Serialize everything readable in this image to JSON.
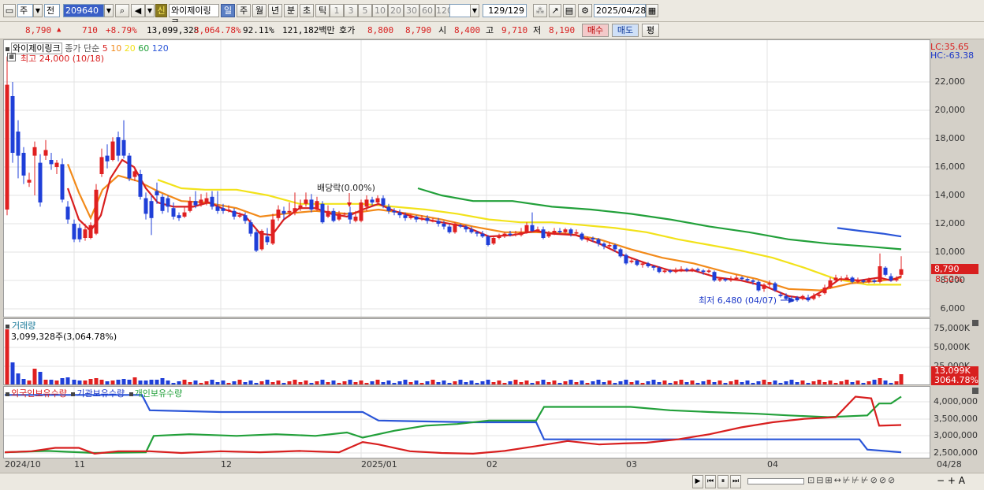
{
  "toolbar": {
    "market_select": "주",
    "mode_select": "전",
    "code": "209640",
    "stock_name": "와이제이링크",
    "new_badge": "신",
    "period_tabs": [
      "일",
      "주",
      "월",
      "년",
      "분",
      "초",
      "틱"
    ],
    "interval_tabs": [
      "1",
      "3",
      "5",
      "10",
      "20",
      "30",
      "60",
      "120"
    ],
    "counter": "129/129",
    "date": "2025/04/28"
  },
  "info": {
    "price": "8,790",
    "arrow": "▲",
    "change": "710",
    "change_pct": "+8.79%",
    "volume": "13,099,328",
    "volume_pct": "3,064.78%",
    "ratio": "92.11%",
    "amount": "121,182백만",
    "quote_label": "호가",
    "quote1": "8,800",
    "quote2": "8,790",
    "open_label": "시",
    "open": "8,400",
    "high_label": "고",
    "high": "9,710",
    "low_label": "저",
    "low": "8,190",
    "buy_button": "매수",
    "sell_button": "매도",
    "eval_button": "평"
  },
  "price_panel": {
    "legend_name": "와이제이링크",
    "legend_close": "종가 단순",
    "ma_labels": [
      {
        "label": "5",
        "color": "#d81f1f"
      },
      {
        "label": "10",
        "color": "#f28a1a"
      },
      {
        "label": "20",
        "color": "#f2e21a"
      },
      {
        "label": "60",
        "color": "#22a03a"
      },
      {
        "label": "120",
        "color": "#2a55d8"
      }
    ],
    "high_note": "최고 24,000 (10/18)",
    "low_note": "최저 6,480 (04/07)",
    "dividend_note": "배당락(0.00%)",
    "lc": "LC:35.65",
    "hc": "HC:-63.38",
    "current_price_tag": "8,790",
    "current_pct_tag": "8.52%",
    "y_ticks": [
      "22,000",
      "20,000",
      "18,000",
      "16,000",
      "14,000",
      "12,000",
      "10,000",
      "8,000",
      "6,000"
    ]
  },
  "volume_panel": {
    "title": "거래량",
    "value": "3,099,328주(3,064.78%)",
    "y_ticks": [
      "75,000K",
      "50,000K",
      "25,000K"
    ],
    "tag1": "13,099K",
    "tag2": "3064.78%"
  },
  "holding_panel": {
    "legend": [
      "외국인보유수량",
      "기관보유수량",
      "개인보유수량"
    ],
    "legend_colors": [
      "#d81f1f",
      "#2a55d8",
      "#22a03a"
    ],
    "y_ticks": [
      "4,000,000",
      "3,500,000",
      "3,000,000",
      "2,500,000"
    ]
  },
  "x_axis": [
    "2024/10",
    "11",
    "12",
    "2025/01",
    "02",
    "03",
    "04",
    "04/28"
  ],
  "colors": {
    "up": "#e02020",
    "down": "#1f3fd8",
    "panel_bg": "#ffffff",
    "grid": "#e3e3e3"
  }
}
